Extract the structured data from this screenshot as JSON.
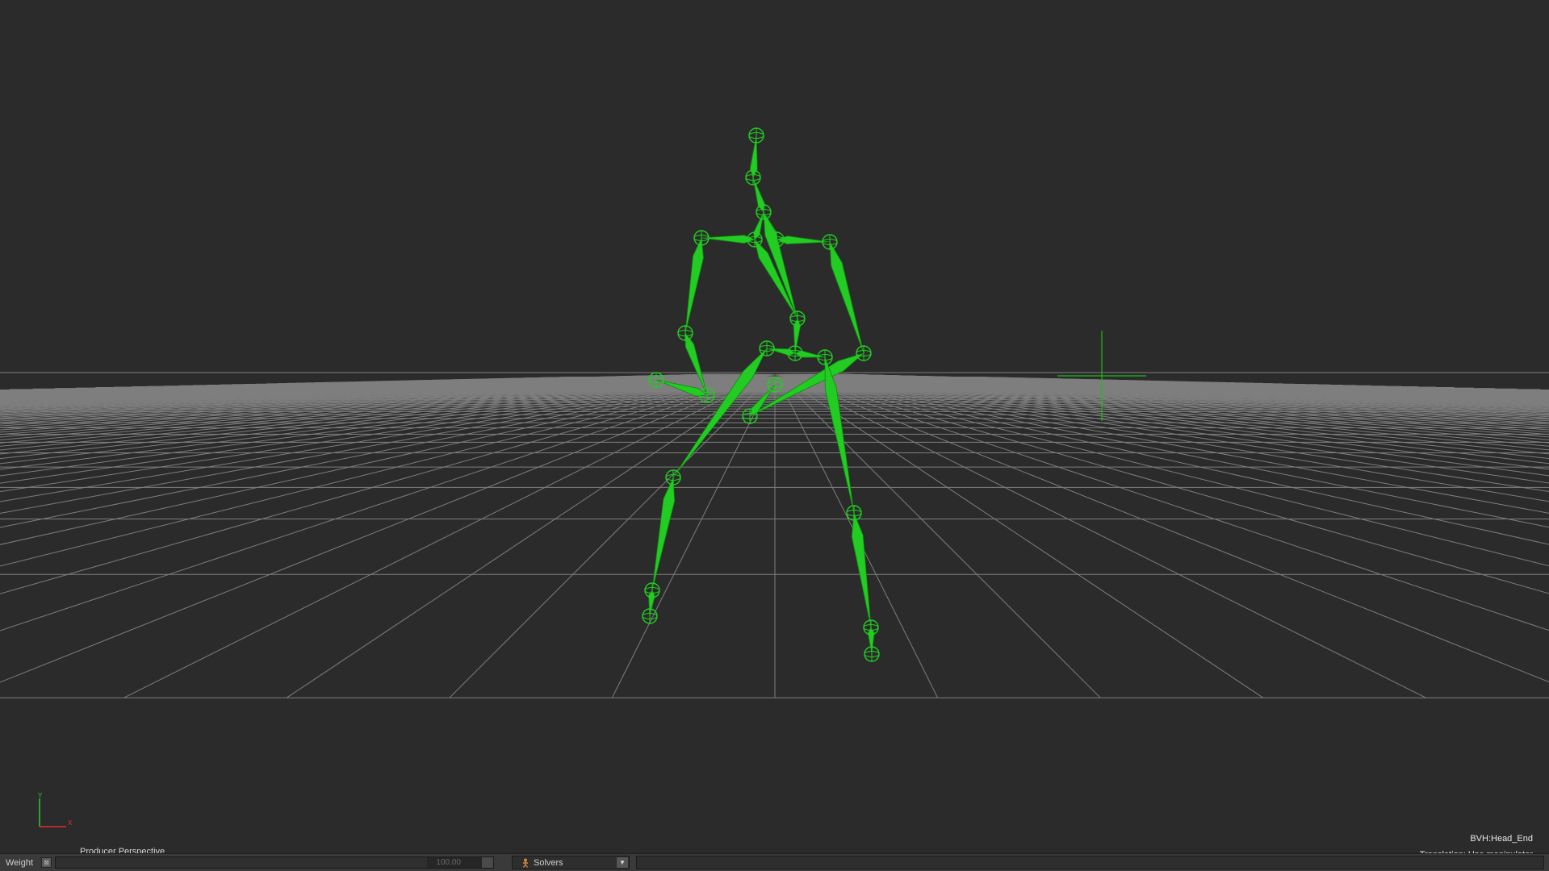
{
  "viewport": {
    "camera_label": "Producer Perspective",
    "selected_object": "BVH:Head_End",
    "manipulator_status": "Translation: Use manipulator",
    "axis_gizmo": {
      "y_label": "Y",
      "x_label": "X"
    },
    "colors": {
      "background": "#2b2b2b",
      "grid": "#9a9a9a",
      "skeleton": "#22cc22",
      "marker": "#18c018"
    }
  },
  "bottom_bar": {
    "weight_label": "Weight",
    "weight_value": "100.00",
    "solvers_label": "Solvers",
    "solvers_icon": "solver-figure-icon"
  }
}
